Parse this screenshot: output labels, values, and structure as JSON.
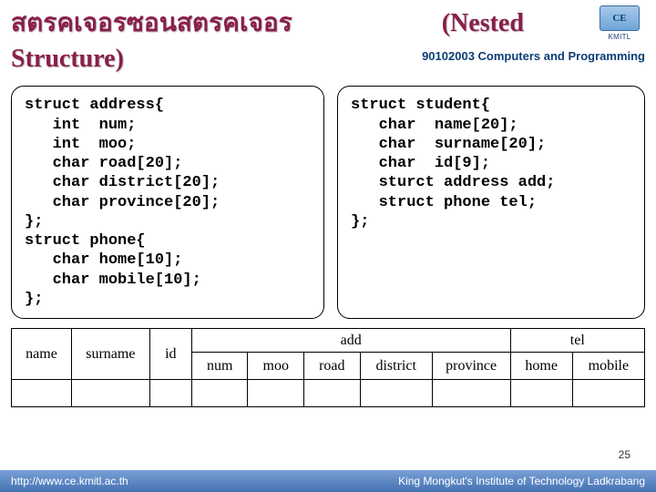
{
  "slide": {
    "title_line1": "สตรคเจอรซอนสตรคเจอร",
    "title_line2": "Structure)",
    "title_right": "(Nested"
  },
  "logo": {
    "badge": "CE",
    "under": "KMITL"
  },
  "course": "90102003 Computers and Programming",
  "code": {
    "left": "struct address{\n   int  num;\n   int  moo;\n   char road[20];\n   char district[20];\n   char province[20];\n};\nstruct phone{\n   char home[10];\n   char mobile[10];\n};",
    "right": "struct student{\n   char  name[20];\n   char  surname[20];\n   char  id[9];\n   sturct address add;\n   struct phone tel;\n};"
  },
  "table": {
    "groups": {
      "add": "add",
      "tel": "tel"
    },
    "headers": [
      "name",
      "surname",
      "id",
      "num",
      "moo",
      "road",
      "district",
      "province",
      "home",
      "mobile"
    ]
  },
  "page_number": "25",
  "footer": {
    "left": "http://www.ce.kmitl.ac.th",
    "right": "King Mongkut's Institute of Technology Ladkrabang"
  }
}
